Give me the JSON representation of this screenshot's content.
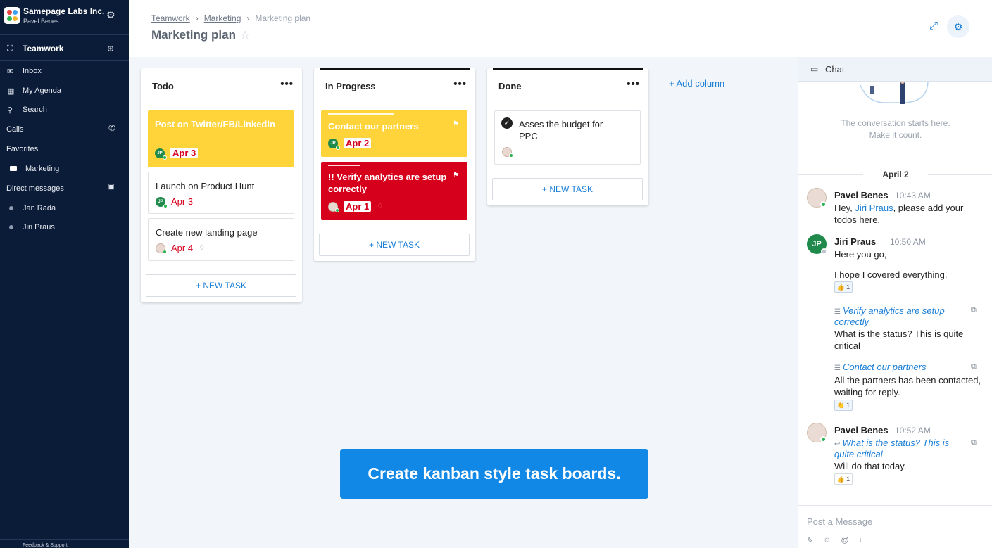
{
  "org": {
    "name": "Samepage Labs Inc.",
    "user": "Pavel Benes"
  },
  "sidebar": {
    "team": "Teamwork",
    "inbox": "Inbox",
    "agenda": "My Agenda",
    "search": "Search",
    "calls": "Calls",
    "favorites": "Favorites",
    "favorite_items": [
      "Marketing"
    ],
    "direct_messages": "Direct messages",
    "dm_items": [
      "Jan Rada",
      "Jiri Praus"
    ],
    "footer": "Feedback & Support"
  },
  "header": {
    "breadcrumbs": [
      "Teamwork",
      "Marketing",
      "Marketing plan"
    ],
    "title": "Marketing plan"
  },
  "board": {
    "columns": [
      {
        "title": "Todo",
        "cards": [
          {
            "title": "Post on Twitter/FB/Linkedin",
            "avatar": "JP",
            "due": "Apr 3"
          },
          {
            "title": "Launch on Product Hunt",
            "avatar": "JP",
            "due": "Apr 3"
          },
          {
            "title": "Create new landing page",
            "due": "Apr 4"
          }
        ]
      },
      {
        "title": "In Progress",
        "cards": [
          {
            "title": "Contact our partners",
            "avatar": "JP",
            "due": "Apr 2"
          },
          {
            "title": "!! Verify analytics are setup correctly",
            "due": "Apr 1"
          }
        ]
      },
      {
        "title": "Done",
        "cards": [
          {
            "title": "Asses the budget for PPC"
          }
        ]
      }
    ],
    "new_task": "+ NEW TASK",
    "add_column": "+ Add column",
    "banner": "Create kanban style task boards."
  },
  "chat": {
    "title": "Chat",
    "starts_line1": "The conversation starts here.",
    "starts_line2": "Make it count.",
    "date": "April 2",
    "messages": [
      {
        "name": "Pavel Benes",
        "time": "10:43 AM",
        "text_before": "Hey, ",
        "mention": "Jiri Praus",
        "text_after": ", please add your todos here."
      },
      {
        "name": "Jiri Praus",
        "initials": "JP",
        "time": "10:50 AM",
        "text1": "Here you go,",
        "text2": "I hope I covered everything.",
        "reaction_count": "1",
        "ref1": "Verify analytics are setup correctly",
        "ref1_text": "What is the status? This is quite critical",
        "ref2": "Contact our partners",
        "ref2_text": "All the partners has been contacted, waiting for reply.",
        "reaction2_count": "1"
      },
      {
        "name": "Pavel Benes",
        "time": "10:52 AM",
        "ref": "What is the status? This is quite critical",
        "text": "Will do that today.",
        "reaction_count": "1"
      }
    ],
    "input_placeholder": "Post a Message"
  }
}
